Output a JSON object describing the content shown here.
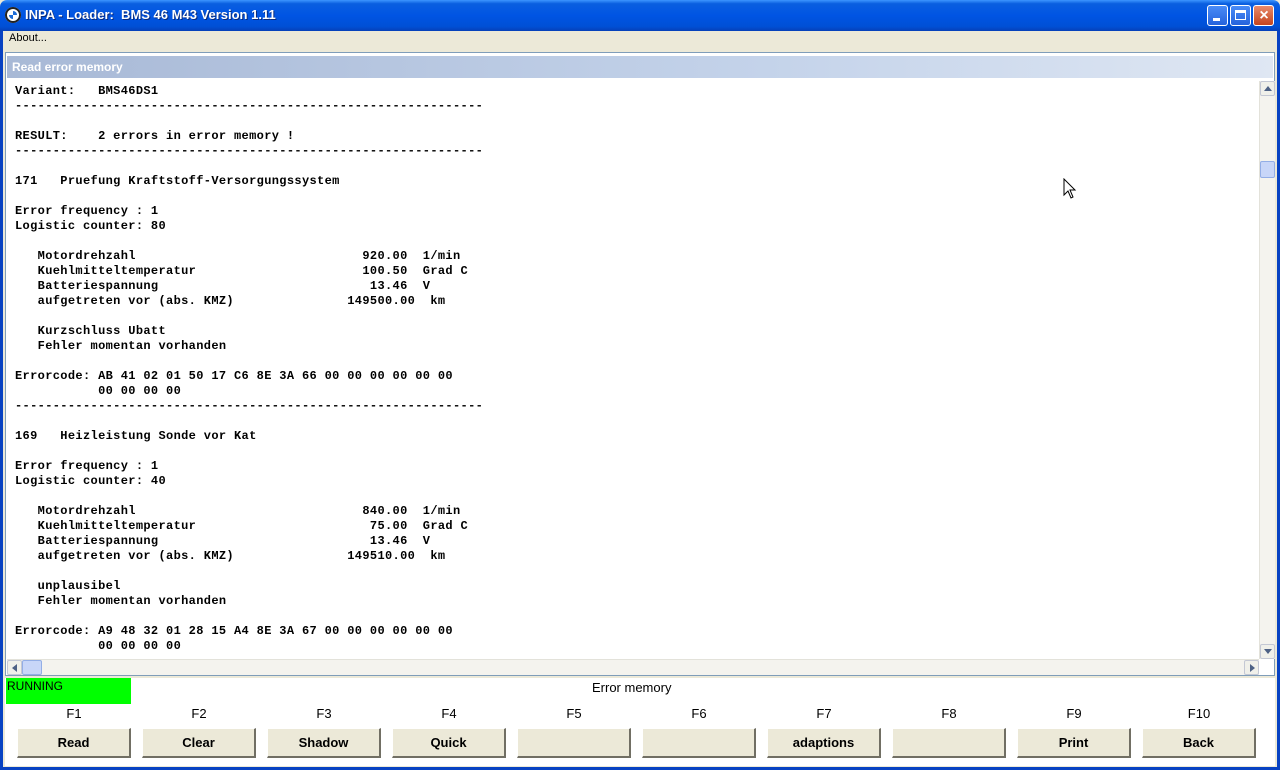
{
  "window": {
    "title": "INPA - Loader:  BMS 46 M43 Version 1.11"
  },
  "menu": {
    "items": [
      "About..."
    ]
  },
  "panel": {
    "title": "Read error memory",
    "lines": [
      "Variant:   BMS46DS1",
      "--------------------------------------------------------------",
      "",
      "RESULT:    2 errors in error memory !",
      "--------------------------------------------------------------",
      "",
      "171   Pruefung Kraftstoff-Versorgungssystem",
      "",
      "Error frequency : 1",
      "Logistic counter: 80",
      "",
      "   Motordrehzahl                              920.00  1/min",
      "   Kuehlmitteltemperatur                      100.50  Grad C",
      "   Batteriespannung                            13.46  V",
      "   aufgetreten vor (abs. KMZ)               149500.00  km",
      "",
      "   Kurzschluss Ubatt",
      "   Fehler momentan vorhanden",
      "",
      "Errorcode: AB 41 02 01 50 17 C6 8E 3A 66 00 00 00 00 00 00",
      "           00 00 00 00",
      "--------------------------------------------------------------",
      "",
      "169   Heizleistung Sonde vor Kat",
      "",
      "Error frequency : 1",
      "Logistic counter: 40",
      "",
      "   Motordrehzahl                              840.00  1/min",
      "   Kuehlmitteltemperatur                       75.00  Grad C",
      "   Batteriespannung                            13.46  V",
      "   aufgetreten vor (abs. KMZ)               149510.00  km",
      "",
      "   unplausibel",
      "   Fehler momentan vorhanden",
      "",
      "Errorcode: A9 48 32 01 28 15 A4 8E 3A 67 00 00 00 00 00 00",
      "           00 00 00 00"
    ]
  },
  "status": {
    "text": "RUNNING",
    "color": "#00ff00"
  },
  "screen_title": "Error memory",
  "function_keys": [
    {
      "key": "F1",
      "label": "Read"
    },
    {
      "key": "F2",
      "label": "Clear"
    },
    {
      "key": "F3",
      "label": "Shadow"
    },
    {
      "key": "F4",
      "label": "Quick"
    },
    {
      "key": "F5",
      "label": ""
    },
    {
      "key": "F6",
      "label": ""
    },
    {
      "key": "F7",
      "label": "adaptions"
    },
    {
      "key": "F8",
      "label": ""
    },
    {
      "key": "F9",
      "label": "Print"
    },
    {
      "key": "F10",
      "label": "Back"
    }
  ]
}
